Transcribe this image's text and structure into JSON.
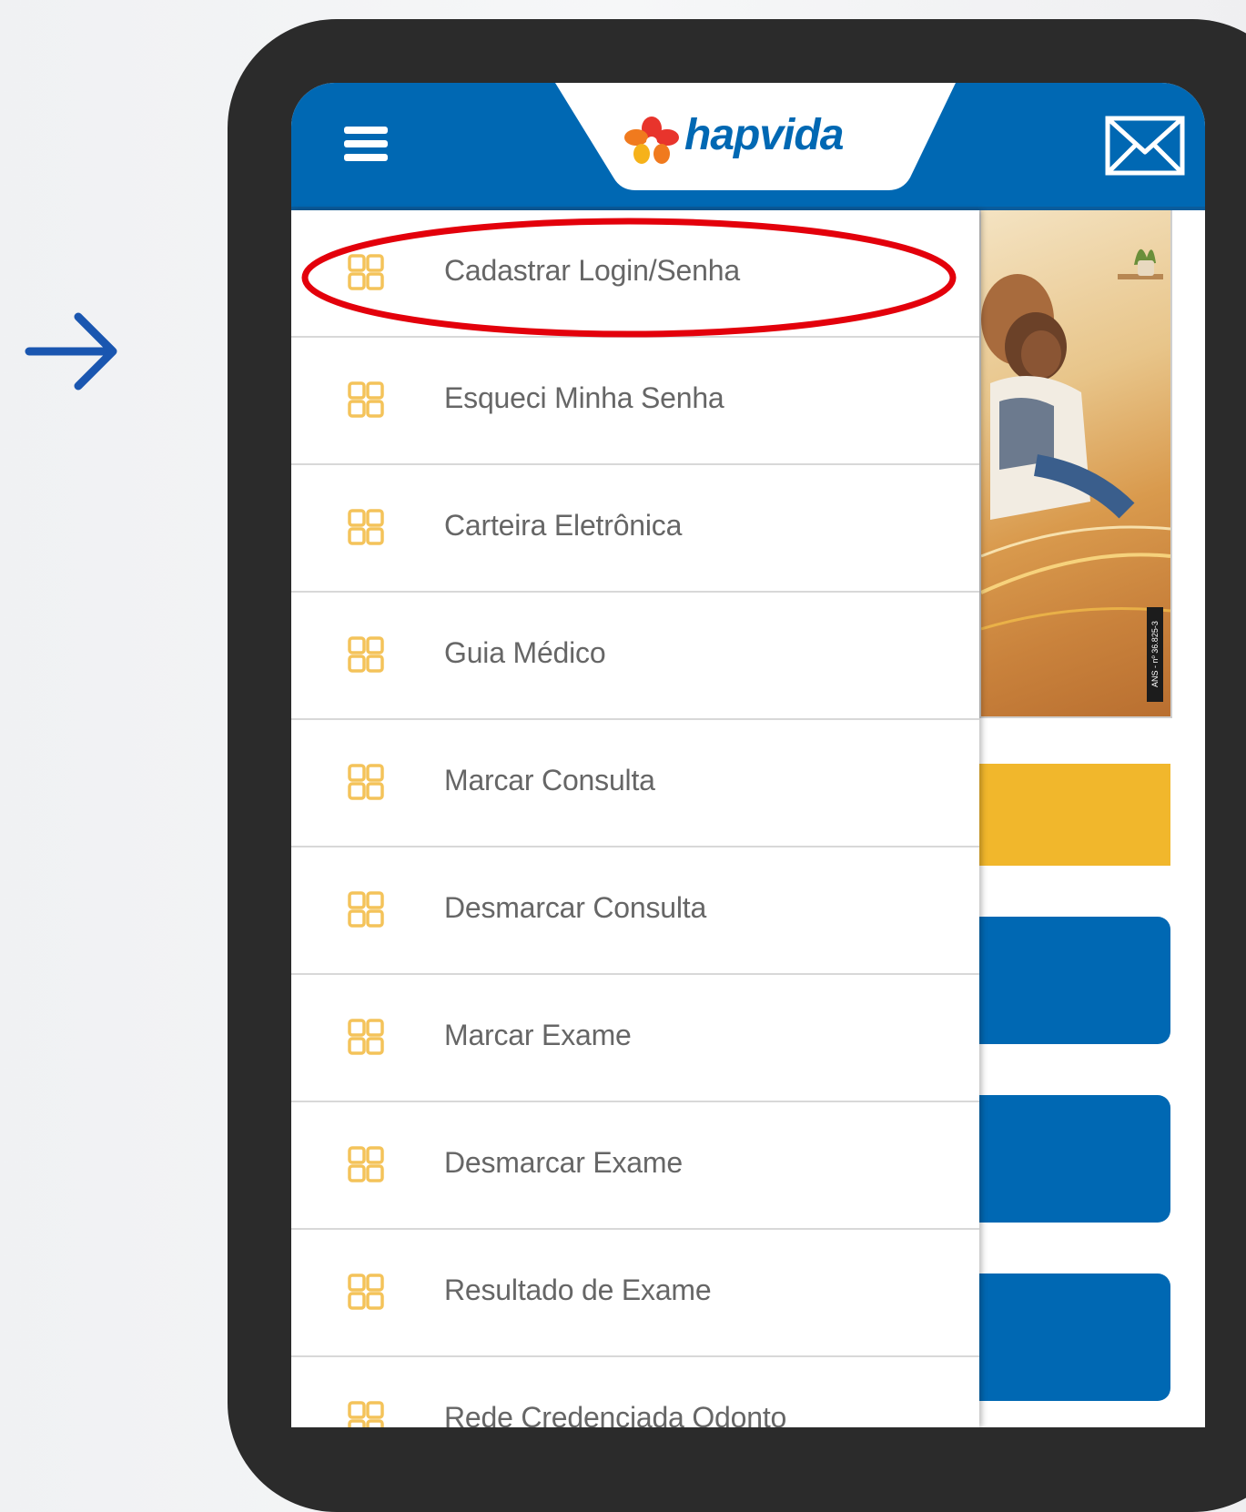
{
  "app": {
    "brand": "hapvida"
  },
  "colors": {
    "primary_blue": "#0068b3",
    "accent_yellow": "#f1b72c",
    "icon_orange": "#f4c35a",
    "highlight_red": "#e3000b"
  },
  "icons": {
    "menu": "hamburger-icon",
    "mail": "mail-icon",
    "item": "grid-icon",
    "arrow": "arrow-right-icon"
  },
  "menu": {
    "items": [
      {
        "label": "Cadastrar Login/Senha"
      },
      {
        "label": "Esqueci Minha Senha"
      },
      {
        "label": "Carteira Eletrônica"
      },
      {
        "label": "Guia Médico"
      },
      {
        "label": "Marcar Consulta"
      },
      {
        "label": "Desmarcar Consulta"
      },
      {
        "label": "Marcar Exame"
      },
      {
        "label": "Desmarcar Exame"
      },
      {
        "label": "Resultado de Exame"
      },
      {
        "label": "Rede Credenciada Odonto"
      }
    ]
  },
  "banner": {
    "badge": "ANS - nº 36.825-3"
  }
}
